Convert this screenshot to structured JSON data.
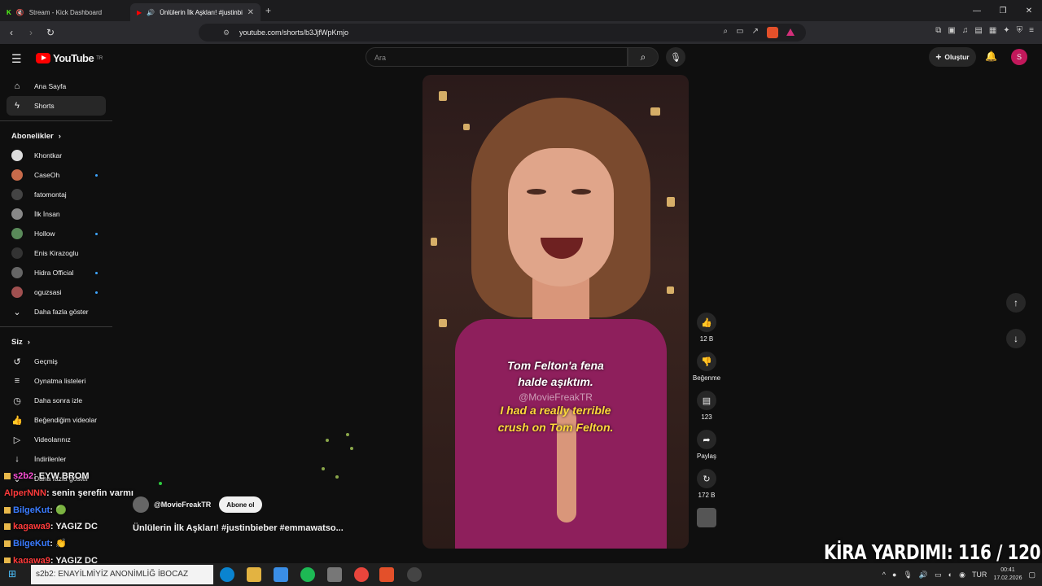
{
  "tabs": [
    {
      "label": "Stream - Kick Dashboard"
    },
    {
      "label": "Ünlülerin İlk Aşkları! #justinbi..."
    }
  ],
  "address": {
    "url": "youtube.com/shorts/b3JjfWpKmjo"
  },
  "youtube": {
    "logo_text": "YouTube",
    "logo_sup": "TR",
    "search_placeholder": "Ara",
    "create_label": "Oluştur",
    "user_initial": "S"
  },
  "sidebar": {
    "main": [
      {
        "label": "Ana Sayfa"
      },
      {
        "label": "Shorts"
      }
    ],
    "subs_header": "Abonelikler",
    "subs": [
      {
        "label": "Khontkar"
      },
      {
        "label": "CaseOh"
      },
      {
        "label": "fatomontaj"
      },
      {
        "label": "İlk İnsan"
      },
      {
        "label": "Hollow"
      },
      {
        "label": "Enis Kirazoglu"
      },
      {
        "label": "Hidra Official"
      },
      {
        "label": "oguzsasi"
      },
      {
        "label": "Daha fazla göster"
      }
    ],
    "you_header": "Siz",
    "you": [
      {
        "label": "Geçmiş"
      },
      {
        "label": "Oynatma listeleri"
      },
      {
        "label": "Daha sonra izle"
      },
      {
        "label": "Beğendiğim videolar"
      },
      {
        "label": "Videolarınız"
      },
      {
        "label": "İndirilenler"
      },
      {
        "label": "Daha fazla göster"
      }
    ]
  },
  "video": {
    "caption_tr_1": "Tom Felton'a fena",
    "caption_tr_2": "halde aşıktım.",
    "watermark": "@MovieFreakTR",
    "caption_en_1": "I had a really terrible",
    "caption_en_2": "crush on Tom Felton.",
    "channel": "@MovieFreakTR",
    "subscribe": "Abone ol",
    "title": "Ünlülerin İlk Aşkları! #justinbieber #emmawatso..."
  },
  "actions": {
    "likes": "12 B",
    "dislike": "Beğenme",
    "comments": "123",
    "share": "Paylaş",
    "remix": "172 B"
  },
  "chat": [
    {
      "user": "s2b2",
      "msg": ": EYW BROM",
      "color": "#ff4fd8"
    },
    {
      "user": "AlperNNN",
      "msg": ": senin şerefin varmı",
      "color": "#ff3b3b"
    },
    {
      "user": "BilgeKut",
      "msg": ": 🟢",
      "color": "#3a7bff"
    },
    {
      "user": "kagawa9",
      "msg": ": YAGIZ DC",
      "color": "#ff3b3b"
    },
    {
      "user": "BilgeKut",
      "msg": ": 👏",
      "color": "#3a7bff"
    },
    {
      "user": "kagawa9",
      "msg": ": YAGIZ DC",
      "color": "#ff3b3b"
    }
  ],
  "overlay": {
    "kira": "KİRA YARDIMI:  116 / 120"
  },
  "taskbar": {
    "search_text": "s2b2: ENAYİLMİYİZ ANONİMLİĞ İBOCAZ",
    "lang": "TUR",
    "time": "00:41",
    "date": "17.02.2026"
  }
}
